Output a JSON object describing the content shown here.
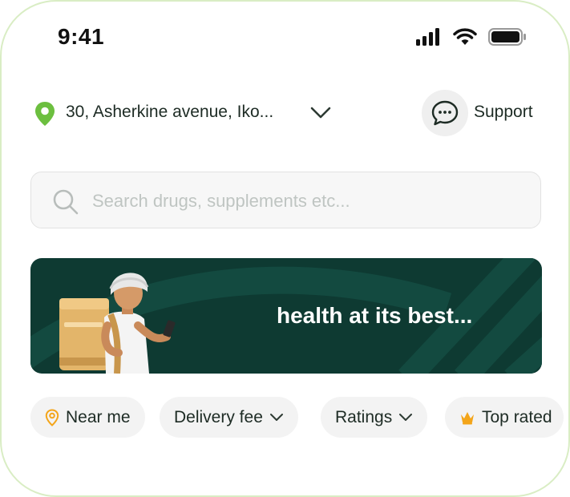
{
  "status_bar": {
    "time": "9:41"
  },
  "location": {
    "address": "30, Asherkine avenue, Iko..."
  },
  "support": {
    "label": "Support"
  },
  "search": {
    "placeholder": "Search drugs, supplements etc..."
  },
  "banner": {
    "tagline": "health at its best..."
  },
  "filters": [
    {
      "label": "Near me",
      "icon": "location-pin-icon"
    },
    {
      "label": "Delivery fee",
      "icon": "chevron-down-icon"
    },
    {
      "label": "Ratings",
      "icon": "chevron-down-icon"
    },
    {
      "label": "Top rated",
      "icon": "crown-icon"
    }
  ],
  "colors": {
    "brand_green": "#0e3a32",
    "pin_green": "#6cbf3f",
    "crown": "#f3a51a",
    "chip_bg": "#f3f3f3"
  }
}
